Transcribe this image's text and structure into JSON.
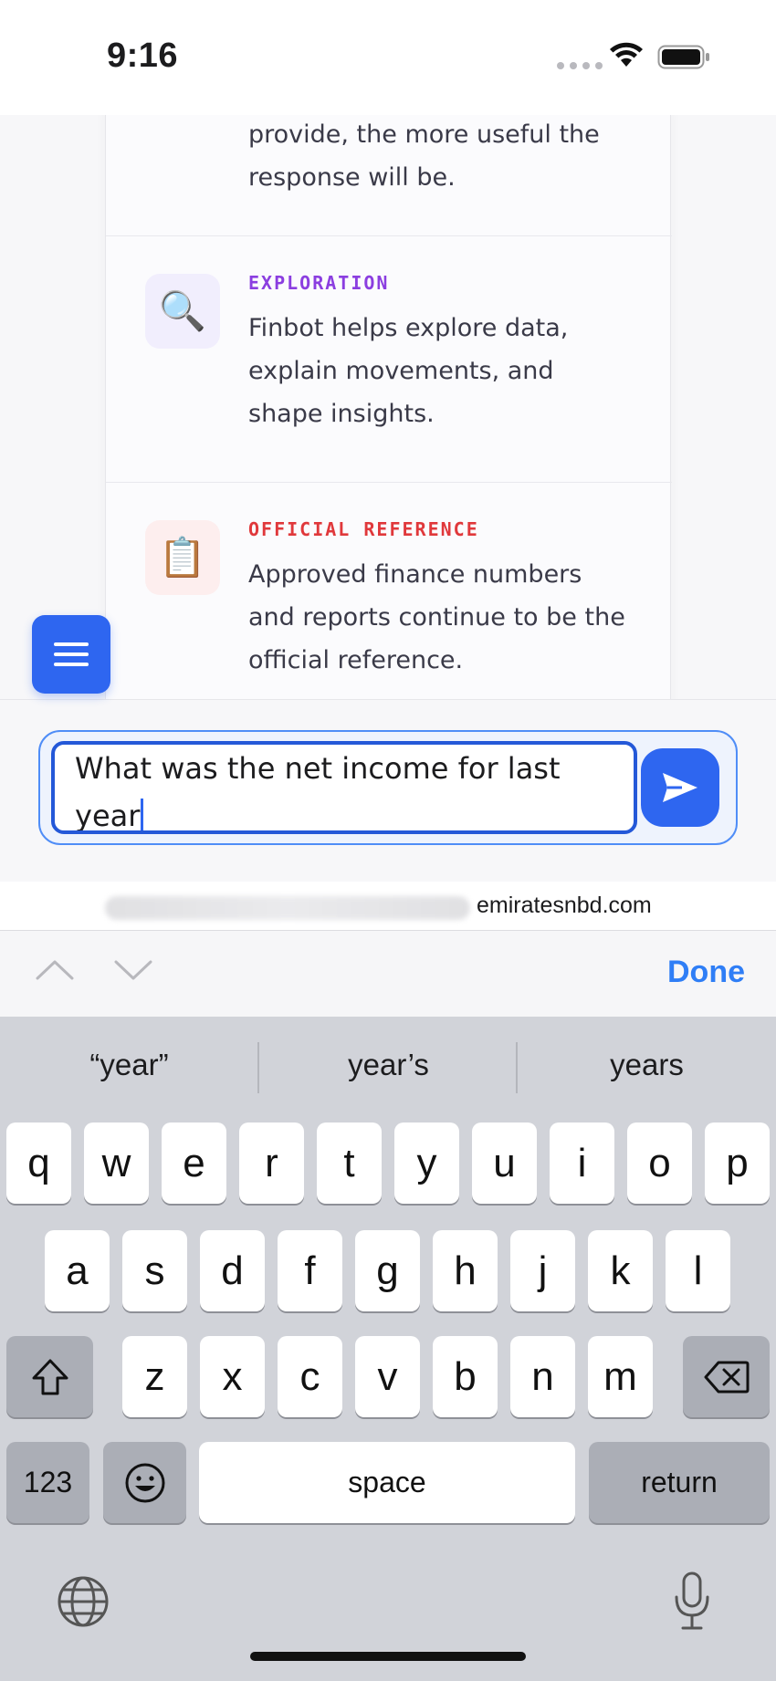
{
  "status_bar": {
    "time": "9:16"
  },
  "content": {
    "intro_tail": "provide, the more useful the response will be.",
    "features": [
      {
        "icon": "magnifying-glass-icon",
        "glyph": "🔍",
        "label": "EXPLORATION",
        "text": "Finbot helps explore data, explain movements, and shape insights."
      },
      {
        "icon": "clipboard-icon",
        "glyph": "📋",
        "label": "OFFICIAL REFERENCE",
        "text": "Approved finance numbers and reports continue to be the official reference."
      }
    ]
  },
  "composer": {
    "value": "What was the net income for last year"
  },
  "browser": {
    "domain": "emiratesnbd.com"
  },
  "accessory": {
    "done_label": "Done"
  },
  "keyboard": {
    "suggestions": [
      "“year”",
      "year’s",
      "years"
    ],
    "row1": [
      "q",
      "w",
      "e",
      "r",
      "t",
      "y",
      "u",
      "i",
      "o",
      "p"
    ],
    "row2": [
      "a",
      "s",
      "d",
      "f",
      "g",
      "h",
      "j",
      "k",
      "l"
    ],
    "row3": [
      "z",
      "x",
      "c",
      "v",
      "b",
      "n",
      "m"
    ],
    "numbers_label": "123",
    "space_label": "space",
    "return_label": "return"
  },
  "colors": {
    "accent": "#2e66f0",
    "exploration": "#8b3ee0",
    "official": "#e0383b",
    "done": "#2f7ef6"
  }
}
